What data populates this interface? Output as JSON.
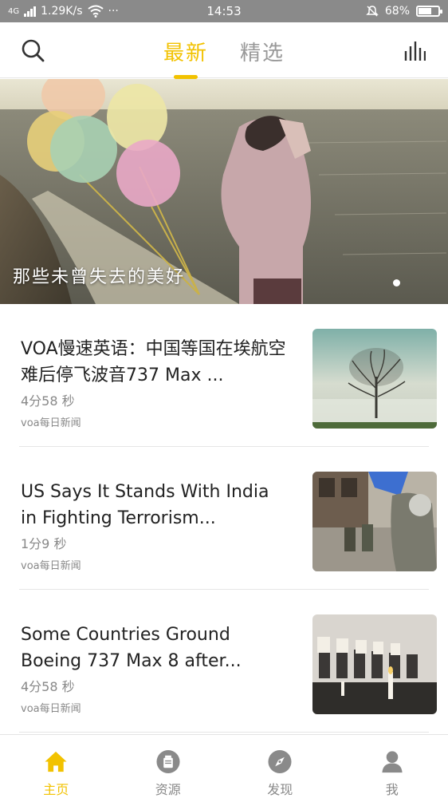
{
  "status_bar": {
    "network": "4G",
    "speed": "1.29K/s",
    "more": "···",
    "time": "14:53",
    "battery": "68%",
    "battery_level": 0.68
  },
  "header": {
    "tabs": [
      {
        "label": "最新",
        "active": true
      },
      {
        "label": "精选",
        "active": false
      }
    ]
  },
  "banner": {
    "caption": "那些未曾失去的美好"
  },
  "articles": [
    {
      "title": "VOA慢速英语：中国等国在埃航空难后停飞波音737 Max ...",
      "duration": "4分58 秒",
      "source": "voa每日新闻"
    },
    {
      "title": "US Says It Stands With India in Fighting Terrorism...",
      "duration": "1分9 秒",
      "source": "voa每日新闻"
    },
    {
      "title": "Some Countries Ground Boeing 737 Max 8 after...",
      "duration": "4分58 秒",
      "source": "voa每日新闻"
    }
  ],
  "bottom_nav": [
    {
      "label": "主页",
      "icon": "home-icon",
      "active": true
    },
    {
      "label": "资源",
      "icon": "resource-icon",
      "active": false
    },
    {
      "label": "发现",
      "icon": "compass-icon",
      "active": false
    },
    {
      "label": "我",
      "icon": "user-icon",
      "active": false
    }
  ],
  "colors": {
    "accent": "#f2c200",
    "status_bar": "#8a8a8a",
    "muted_text": "#888888"
  }
}
